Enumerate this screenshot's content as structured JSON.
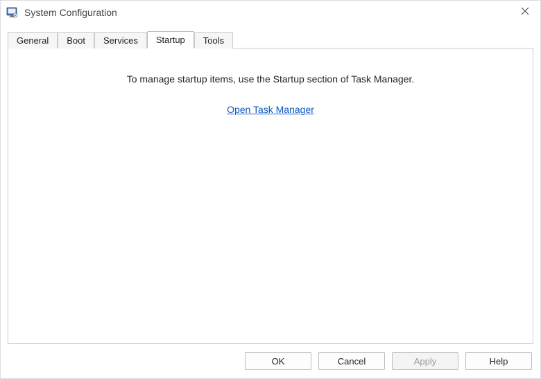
{
  "window": {
    "title": "System Configuration"
  },
  "tabs": [
    {
      "label": "General",
      "active": false
    },
    {
      "label": "Boot",
      "active": false
    },
    {
      "label": "Services",
      "active": false
    },
    {
      "label": "Startup",
      "active": true
    },
    {
      "label": "Tools",
      "active": false
    }
  ],
  "panel": {
    "message": "To manage startup items, use the Startup section of Task Manager.",
    "link_label": "Open Task Manager"
  },
  "footer": {
    "ok": "OK",
    "cancel": "Cancel",
    "apply": "Apply",
    "help": "Help",
    "apply_enabled": false
  }
}
